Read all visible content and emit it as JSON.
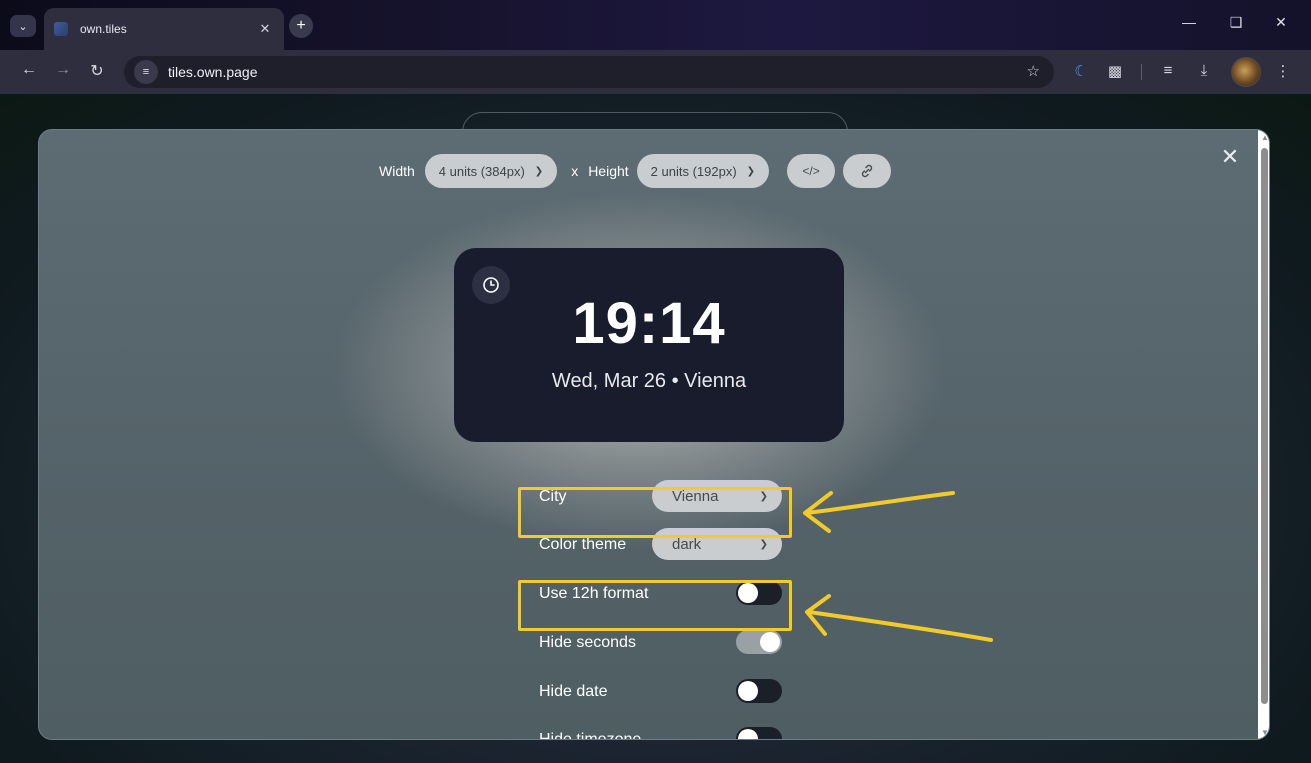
{
  "browser": {
    "tab_title": "own.tiles",
    "url": "tiles.own.page"
  },
  "modal": {
    "width_label": "Width",
    "width_value": "4 units (384px)",
    "times_symbol": "x",
    "height_label": "Height",
    "height_value": "2 units (192px)",
    "embed_icon": "code-icon",
    "link_icon": "link-icon"
  },
  "clock": {
    "time": "19:14",
    "date_line": "Wed, Mar 26 • Vienna"
  },
  "settings": {
    "city_label": "City",
    "city_value": "Vienna",
    "color_theme_label": "Color theme",
    "color_theme_value": "dark",
    "use12h_label": "Use 12h format",
    "use12h_on": false,
    "hide_seconds_label": "Hide seconds",
    "hide_seconds_on": true,
    "hide_date_label": "Hide date",
    "hide_date_on": false,
    "hide_timezone_label": "Hide timezone",
    "hide_timezone_on": false
  },
  "colors": {
    "highlight": "#f2cb2a",
    "card_bg": "#191c2c",
    "accent_blue": "#3b9aff"
  }
}
